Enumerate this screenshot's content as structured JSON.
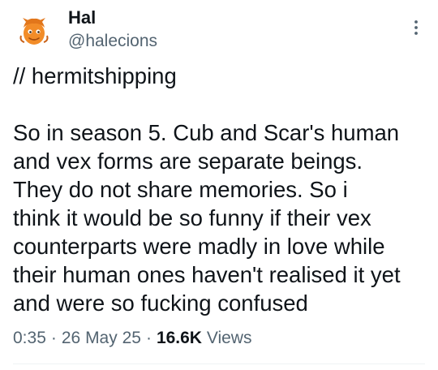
{
  "author": {
    "display_name": "Hal",
    "handle": "@halecions",
    "avatar_icon": "orange-cartoon-avatar-icon"
  },
  "menu": {
    "icon": "more-vertical-icon"
  },
  "tweet": {
    "tag_line": "// hermitshipping",
    "body_lines": [
      "So in season 5. Cub and Scar's human",
      "and vex forms are separate beings.",
      "They do not share memories. So i",
      "think it would be so funny if their vex",
      "counterparts were madly in love while",
      "their human ones haven't realised it yet",
      "and were so fucking confused"
    ]
  },
  "meta": {
    "time": "0:35",
    "separator": "·",
    "date": "26 May 25",
    "views_count": "16.6K",
    "views_label": "Views"
  },
  "colors": {
    "text_primary": "#0f1419",
    "text_secondary": "#536471",
    "divider": "#eff3f4"
  }
}
